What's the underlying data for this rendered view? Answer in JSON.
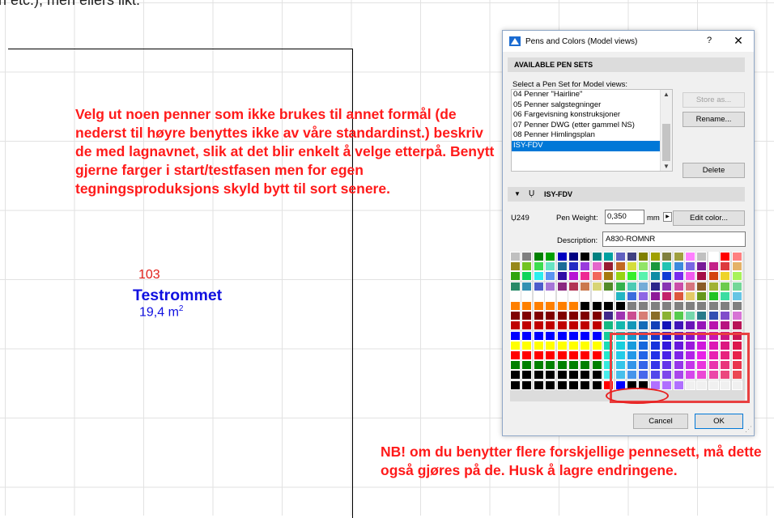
{
  "background_text": "n etc.), men ellers likt.",
  "annotations": {
    "main": "Velg ut noen penner som ikke brukes til annet formål (de nederst til høyre benyttes ikke av våre standardinst.) beskriv de med lagnavnet, slik at det blir enkelt å velge etterpå. Benytt gjerne farger i start/testfasen men for egen tegningsproduksjons skyld bytt til sort senere.",
    "note": "NB! om du benytter flere forskjellige pennesett, må dette også gjøres på de. Husk å lagre endringene."
  },
  "room": {
    "number": "103",
    "name": "Testrommet",
    "area": "19,4 m",
    "area_unit_sup": "2"
  },
  "dialog": {
    "title": "Pens and Colors (Model views)",
    "help": "?",
    "close": "✕",
    "available_header": "AVAILABLE PEN SETS",
    "select_label": "Select a Pen Set for Model views:",
    "pen_sets": [
      "04 Penner \"Hairline\"",
      "05 Penner salgstegninger",
      "06 Fargevisning konstruksjoner",
      "07 Penner DWG (etter gammel NS)",
      "08 Penner Himlingsplan",
      "ISY-FDV"
    ],
    "selected_index": 5,
    "buttons": {
      "store_as": "Store as...",
      "rename": "Rename...",
      "delete": "Delete",
      "edit_color": "Edit color...",
      "cancel": "Cancel",
      "ok": "OK"
    },
    "current_set_header": "ISY-FDV",
    "pen_index": "249",
    "pen_weight_label": "Pen Weight:",
    "pen_weight_value": "0,350",
    "pen_weight_unit": "mm",
    "description_label": "Description:",
    "description_value": "A830-ROMNR"
  },
  "colors": {
    "annotation": "#ff1a1a",
    "room_name": "#1010e0",
    "room_number": "#e0201a",
    "selection": "#0078d7"
  }
}
